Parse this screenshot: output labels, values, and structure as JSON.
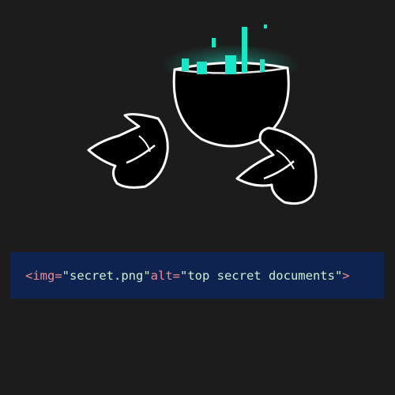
{
  "colors": {
    "background": "#1c1c1c",
    "banner": "#0f2350",
    "tag_text": "#ec8d92",
    "value_text": "#cfeecf",
    "glow": "#19e6c8"
  },
  "illustration": {
    "icon": "shadow-creature-with-glowing-head"
  },
  "code_snippet": {
    "open": "<img=",
    "src_value": "\"secret.png\"",
    "alt_attr": " alt=",
    "alt_value": "\"top secret documents\"",
    "close": ">"
  }
}
